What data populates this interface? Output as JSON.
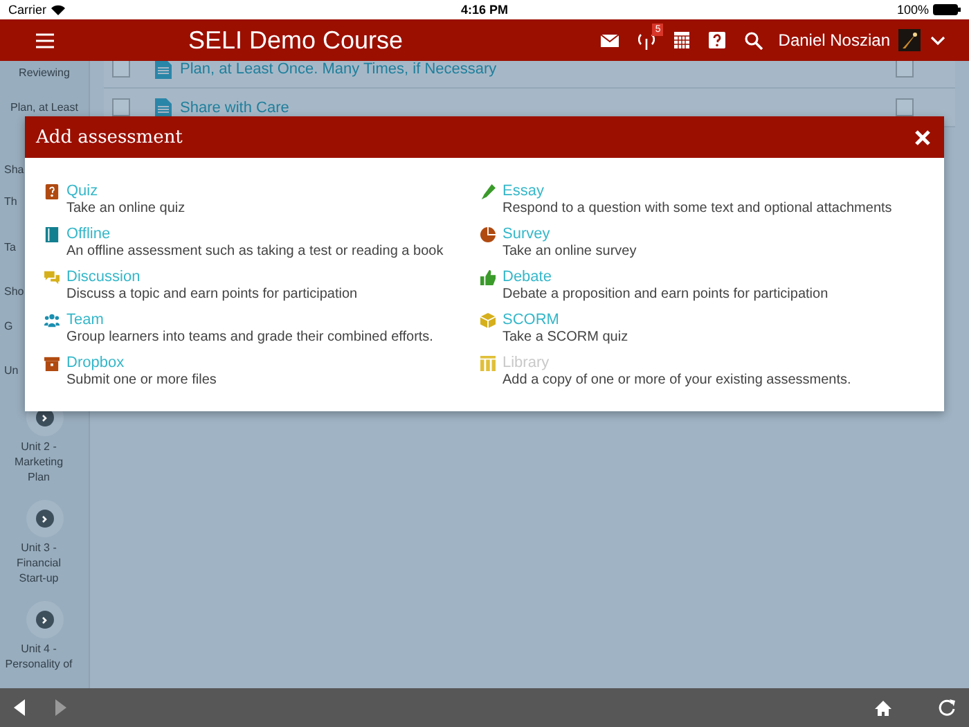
{
  "status_bar": {
    "carrier": "Carrier",
    "time": "4:16 PM",
    "battery": "100%"
  },
  "header": {
    "title": "SELI Demo Course",
    "notification_count": "5",
    "user": "Daniel Noszian"
  },
  "sidebar": {
    "items": [
      {
        "kind": "text",
        "label": "Reviewing"
      },
      {
        "kind": "text",
        "label": "Plan, at Least"
      },
      {
        "kind": "text",
        "label": "Sha"
      },
      {
        "kind": "text",
        "label": "Th"
      },
      {
        "kind": "text",
        "label": "Ta"
      },
      {
        "kind": "text",
        "label": "Sho"
      },
      {
        "kind": "text",
        "label": "G"
      },
      {
        "kind": "text",
        "label": "Un"
      },
      {
        "kind": "unit",
        "label": "Unit 2 - Marketing Plan"
      },
      {
        "kind": "unit",
        "label": "Unit 3 - Financial Start-up"
      },
      {
        "kind": "unit",
        "label": "Unit 4 - Personality of"
      }
    ]
  },
  "content": {
    "rows": [
      {
        "title": "Plan, at Least Once. Many Times, if Necessary",
        "checked": false,
        "done": false
      },
      {
        "title": "Share with Care",
        "checked": false,
        "done": false
      }
    ]
  },
  "dialog": {
    "title": "Add assessment",
    "columns": [
      [
        {
          "kind": "quiz",
          "title": "Quiz",
          "description": "Take an online quiz",
          "disabled": false
        },
        {
          "kind": "offline",
          "title": "Offline",
          "description": "An offline assessment such as taking a test or reading a book",
          "disabled": false
        },
        {
          "kind": "discussion",
          "title": "Discussion",
          "description": "Discuss a topic and earn points for participation",
          "disabled": false
        },
        {
          "kind": "team",
          "title": "Team",
          "description": "Group learners into teams and grade their combined efforts.",
          "disabled": false
        },
        {
          "kind": "dropbox",
          "title": "Dropbox",
          "description": "Submit one or more files",
          "disabled": false
        }
      ],
      [
        {
          "kind": "essay",
          "title": "Essay",
          "description": "Respond to a question with some text and optional attachments",
          "disabled": false
        },
        {
          "kind": "survey",
          "title": "Survey",
          "description": "Take an online survey",
          "disabled": false
        },
        {
          "kind": "debate",
          "title": "Debate",
          "description": "Debate a proposition and earn points for participation",
          "disabled": false
        },
        {
          "kind": "scorm",
          "title": "SCORM",
          "description": "Take a SCORM quiz",
          "disabled": false
        },
        {
          "kind": "library",
          "title": "Library",
          "description": "Add a copy of one or more of your existing assessments.",
          "disabled": true
        }
      ]
    ]
  },
  "footer": {
    "back_disabled": false,
    "forward_disabled": true
  }
}
